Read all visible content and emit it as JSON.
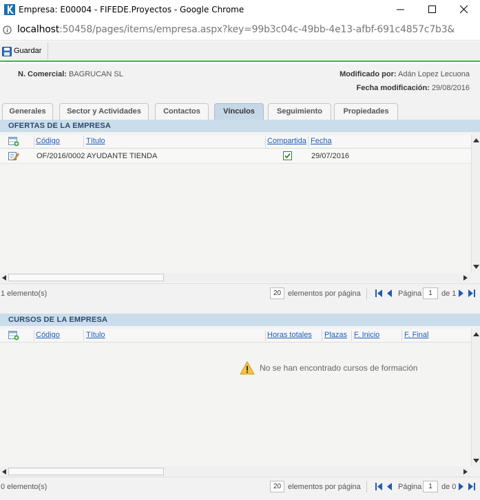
{
  "window": {
    "title": "Empresa: E00004 - FIFEDE.Proyectos - Google Chrome"
  },
  "browser": {
    "url_host": "localhost",
    "url_rest": ":50458/pages/items/empresa.aspx?key=99b3c04c-49bb-4e13-afbf-691c4857c7b3&"
  },
  "toolbar": {
    "save_label": "Guardar"
  },
  "header": {
    "nombre_label": "N. Comercial:",
    "nombre_value": "BAGRUCAN SL",
    "modificado_label": "Modificado por:",
    "modificado_value": "Adán Lopez Lecuona",
    "fecha_label": "Fecha modificación:",
    "fecha_value": "29/08/2016"
  },
  "tabs": [
    {
      "label": "Generales"
    },
    {
      "label": "Sector y Actividades"
    },
    {
      "label": "Contactos"
    },
    {
      "label": "Vínculos",
      "active": true
    },
    {
      "label": "Seguimiento"
    },
    {
      "label": "Propiedades"
    }
  ],
  "ofertas": {
    "title": "OFERTAS DE LA EMPRESA",
    "columns": [
      "Código",
      "Título",
      "Compartida",
      "Fecha"
    ],
    "rows": [
      {
        "codigo": "OF/2016/0002",
        "titulo": "AYUDANTE TIENDA",
        "compartida": true,
        "fecha": "29/07/2016"
      }
    ],
    "pager": {
      "count": "1 elemento(s)",
      "page_size": "20",
      "page_size_label": "elementos por página",
      "pagina_label": "Página",
      "page": "1",
      "of_label": "de 1"
    }
  },
  "cursos": {
    "title": "CURSOS DE LA EMPRESA",
    "columns": [
      "Código",
      "Título",
      "Horas totales",
      "Plazas",
      "F. Inicio",
      "F. Final"
    ],
    "empty_message": "No se han encontrado cursos de formación",
    "pager": {
      "count": "0 elemento(s)",
      "page_size": "20",
      "page_size_label": "elementos por página",
      "pagina_label": "Página",
      "page": "1",
      "of_label": "de 0"
    }
  },
  "colors": {
    "accent_green": "#3cb54a",
    "section_bg": "#cbdceb",
    "link_blue": "#1f5bb5"
  }
}
